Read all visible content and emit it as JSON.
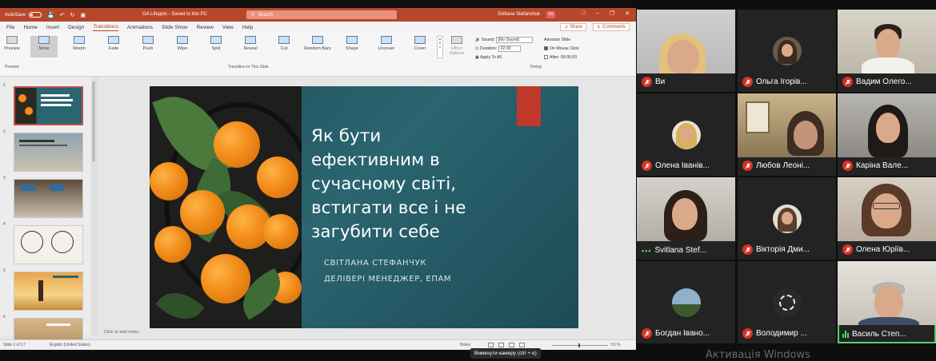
{
  "ppt": {
    "autosave_label": "AutoSave",
    "autosave_state": "Off",
    "doc_title": "GA Lifeppts  -  Saved to this PC",
    "search_placeholder": "Search",
    "user_name": "Svitlana Stefanchuk",
    "user_initials": "SS",
    "menu": [
      "File",
      "Home",
      "Insert",
      "Design",
      "Transitions",
      "Animations",
      "Slide Show",
      "Review",
      "View",
      "Help"
    ],
    "menu_active": "Transitions",
    "share_label": "Share",
    "comments_label": "Comments",
    "preview_label": "Preview",
    "transitions": [
      "None",
      "Morph",
      "Fade",
      "Push",
      "Wipe",
      "Split",
      "Reveal",
      "Cut",
      "Random Bars",
      "Shape",
      "Uncover",
      "Cover"
    ],
    "effect_options_label": "Effect Options",
    "group_preview": "Preview",
    "group_transition": "Transition to This Slide",
    "group_timing": "Timing",
    "timing": {
      "sound_label": "Sound:",
      "sound_value": "[No Sound]",
      "duration_label": "Duration:",
      "duration_value": "02.00",
      "apply_all": "Apply To All",
      "advance_label": "Advance Slide",
      "on_mouse_click": "On Mouse Click",
      "after_label": "After:",
      "after_value": "00:00.00"
    },
    "thumbs": [
      "1",
      "2",
      "3",
      "4",
      "5",
      "6"
    ],
    "slide": {
      "title_lines": [
        "Як бути",
        "ефективним в",
        "сучасному світі,",
        "встигати все і не",
        "загубити себе"
      ],
      "sub_lines": [
        "СВІТЛАНА СТЕФАНЧУК",
        "ДЕЛІВЕРІ МЕНЕДЖЕР, ЕПАМ"
      ]
    },
    "notes_placeholder": "Click to add notes",
    "status": {
      "slide_info": "Slide 1 of 17",
      "language": "English (United States)",
      "notes_btn": "Notes",
      "zoom": "61 %"
    }
  },
  "tooltip": "Вимкнути камеру (ctrl + e)",
  "watermark": "Активація Windows",
  "participants": [
    {
      "name": "Ви",
      "status": "muted"
    },
    {
      "name": "Ольга Ігорів...",
      "status": "muted"
    },
    {
      "name": "Вадим Олего...",
      "status": "muted"
    },
    {
      "name": "Олена Іванів...",
      "status": "muted"
    },
    {
      "name": "Любов Леоні...",
      "status": "muted"
    },
    {
      "name": "Каріна Вале...",
      "status": "muted"
    },
    {
      "name": "Svitlana Stef...",
      "status": "dots"
    },
    {
      "name": "Вікторія Дми...",
      "status": "muted"
    },
    {
      "name": "Олена Юріїв...",
      "status": "muted"
    },
    {
      "name": "Богдан Івано...",
      "status": "muted"
    },
    {
      "name": "Володимир ...",
      "status": "muted"
    },
    {
      "name": "Василь Степ...",
      "status": "speaking"
    }
  ],
  "colors": {
    "ppt_accent": "#b7472a",
    "slide_bg": "#2a6570",
    "muted_red": "#d93025",
    "active_green": "#4cd964"
  }
}
